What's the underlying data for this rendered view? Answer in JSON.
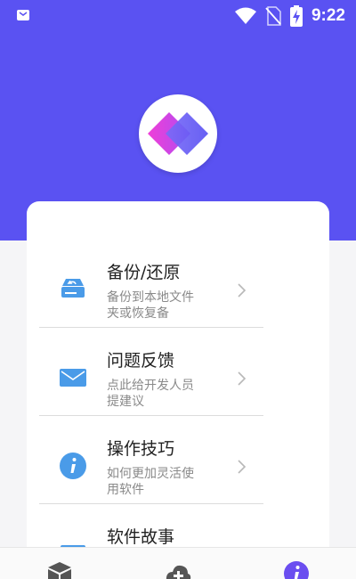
{
  "status_bar": {
    "time": "9:22",
    "icons": [
      "notification-icon",
      "wifi-icon",
      "no-sim-icon",
      "battery-charging-icon"
    ]
  },
  "colors": {
    "header_bg": "#5a52f2",
    "icon_blue": "#4a9be8",
    "logo_pink": "#ef3fd8",
    "logo_purple": "#6b63f5"
  },
  "menu": {
    "items": [
      {
        "title": "备份/还原",
        "desc": "备份到本地文件夹或恢复备",
        "icon": "backup-drive-icon"
      },
      {
        "title": "问题反馈",
        "desc": "点此给开发人员提建议",
        "icon": "mail-icon"
      },
      {
        "title": "操作技巧",
        "desc": "如何更加灵活使用软件",
        "icon": "info-icon"
      },
      {
        "title": "软件故事",
        "desc": "",
        "icon": "card-icon"
      }
    ]
  },
  "bottom_nav": {
    "items": [
      "box-icon",
      "cloud-add-icon",
      "info-icon"
    ]
  }
}
